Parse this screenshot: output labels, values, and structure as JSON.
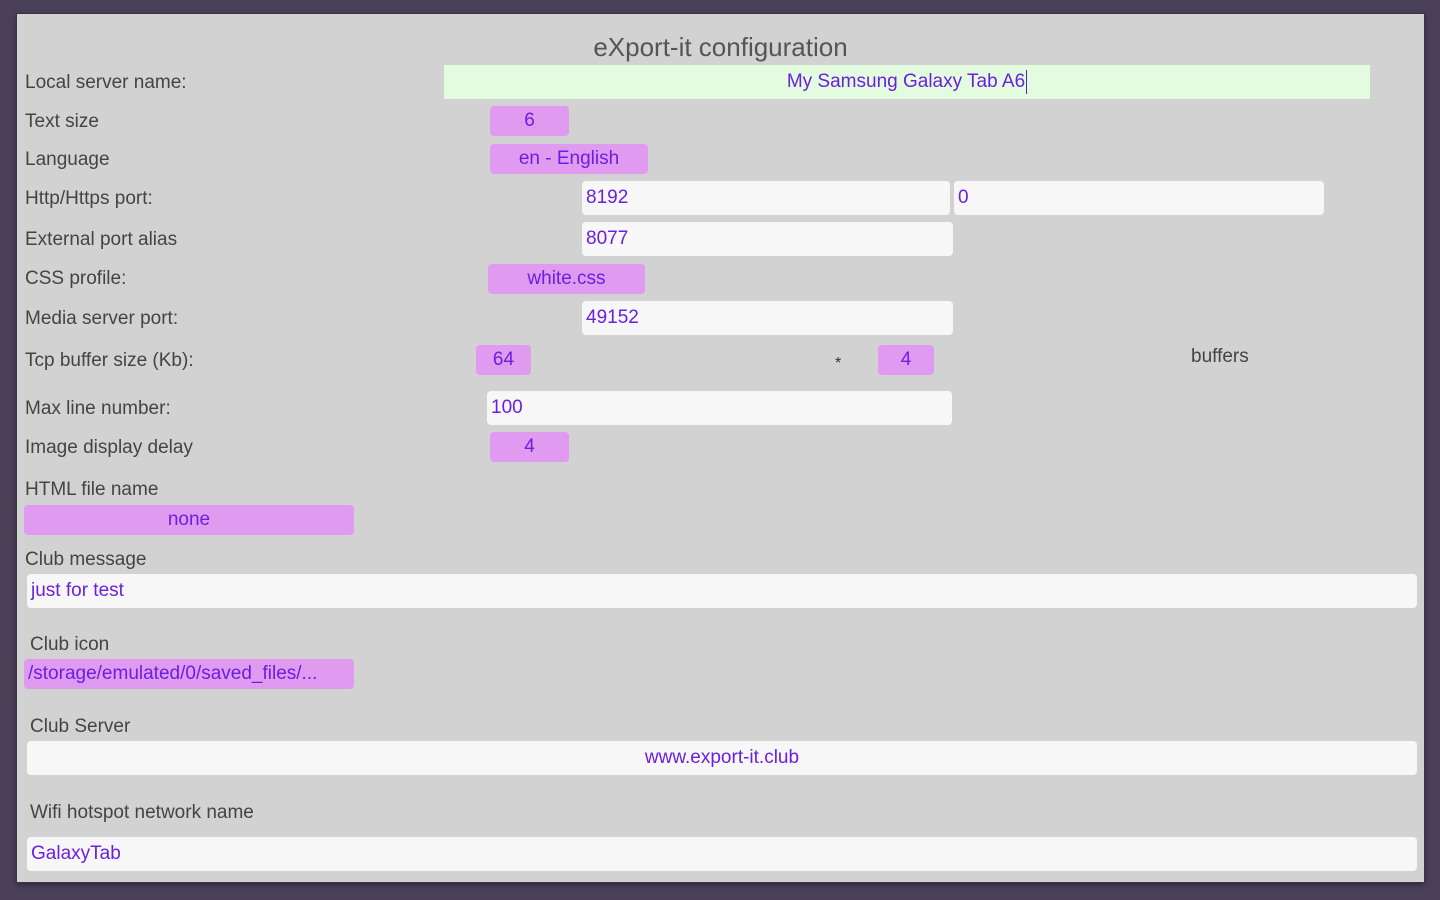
{
  "dialog": {
    "title": "eXport-it configuration"
  },
  "fields": {
    "local_server_name": {
      "label": "Local server name:",
      "value": "My Samsung Galaxy Tab A6"
    },
    "text_size": {
      "label": "Text size",
      "value": "6"
    },
    "language": {
      "label": "Language",
      "value": "en - English"
    },
    "http_port": {
      "label": "Http/Https port:",
      "http_value": "8192",
      "https_value": "0"
    },
    "external_port_alias": {
      "label": "External port alias",
      "value": "8077"
    },
    "css_profile": {
      "label": "CSS profile:",
      "value": "white.css"
    },
    "media_server_port": {
      "label": "Media server port:",
      "value": "49152"
    },
    "tcp_buffer": {
      "label": "Tcp buffer size (Kb):",
      "size_value": "64",
      "multiply_sign": "*",
      "count_value": "4",
      "suffix": "buffers"
    },
    "max_line_number": {
      "label": "Max line number:",
      "value": "100"
    },
    "image_display_delay": {
      "label": "Image display delay",
      "value": "4"
    },
    "html_file_name": {
      "label": "HTML file name",
      "value": "none"
    },
    "club_message": {
      "label": "Club message",
      "value": "just for test"
    },
    "club_icon": {
      "label": "Club icon",
      "value": "/storage/emulated/0/saved_files/..."
    },
    "club_server": {
      "label": "Club Server",
      "value": "www.export-it.club"
    },
    "wifi_hotspot": {
      "label": "Wifi hotspot network name",
      "value": "GalaxyTab"
    }
  },
  "colors": {
    "dialog_background": "#d2d2d2",
    "input_text": "#6b1fe0",
    "spinner_background": "#e09af0",
    "focused_input_background": "#e3fce0",
    "text_input_background": "#f7f7f7"
  }
}
